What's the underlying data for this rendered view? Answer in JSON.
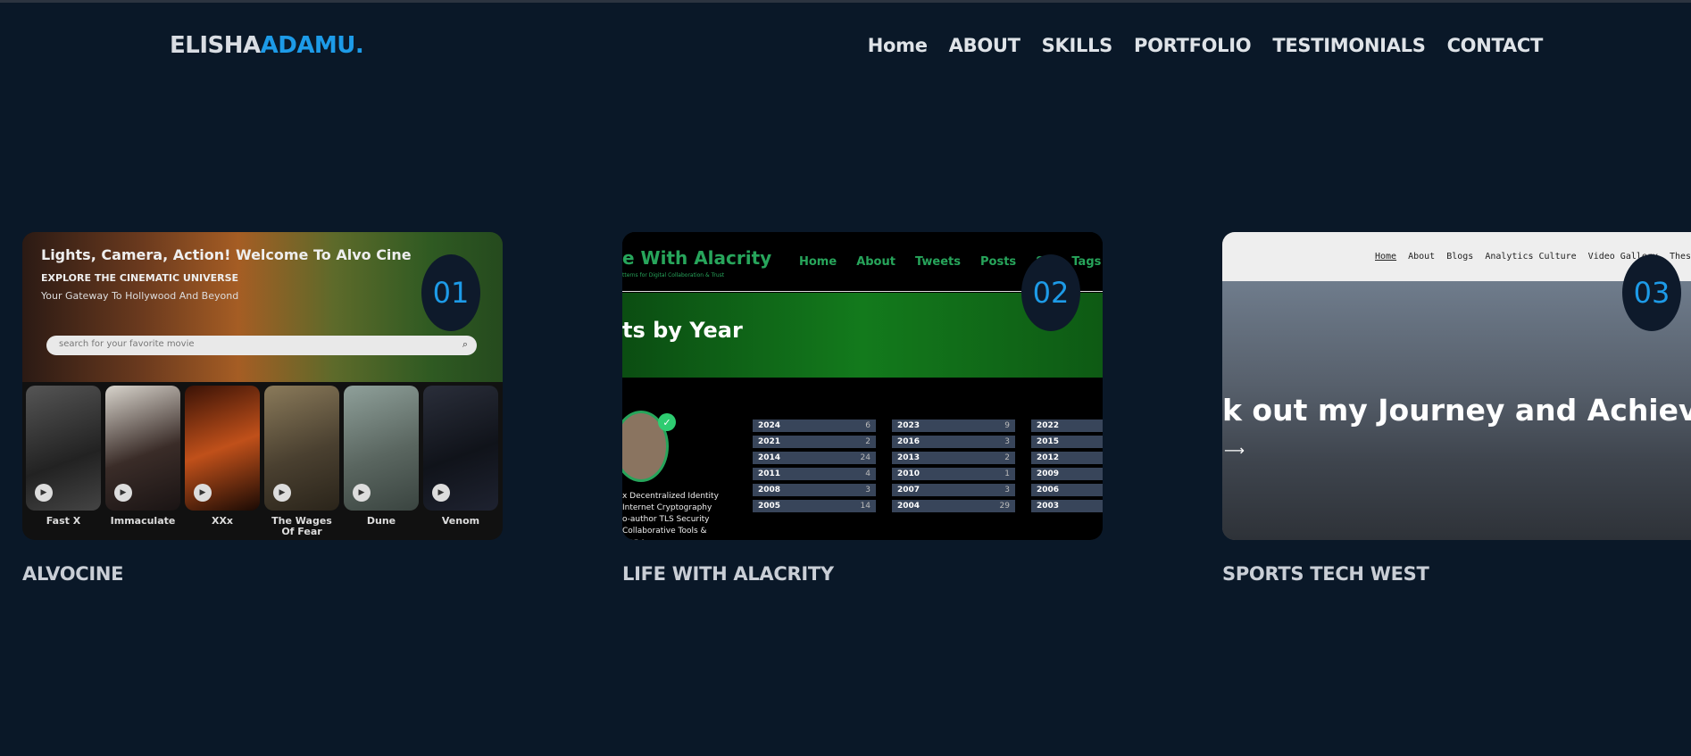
{
  "header": {
    "logo_first": "ELISHA",
    "logo_second": "ADAMU.",
    "nav": [
      "Home",
      "ABOUT",
      "SKILLS",
      "PORTFOLIO",
      "TESTIMONIALS",
      "CONTACT"
    ]
  },
  "projects": [
    {
      "number": "01",
      "title": "ALVOCINE",
      "preview": {
        "heading": "Lights, Camera, Action! Welcome To Alvo Cine",
        "subheading": "EXPLORE THE CINEMATIC UNIVERSE",
        "tagline": "Your Gateway To Hollywood And Beyond",
        "search_placeholder": "search for your favorite movie",
        "movies": [
          "Fast X",
          "Immaculate",
          "XXx",
          "The Wages Of Fear",
          "Dune",
          "Venom"
        ]
      }
    },
    {
      "number": "02",
      "title": "LIFE WITH ALACRITY",
      "preview": {
        "site_title": "e With Alacrity",
        "site_subtitle": "tterns for Digital Collaboration & Trust",
        "nav": [
          "Home",
          "About",
          "Tweets",
          "Posts",
          "Se",
          "Tags"
        ],
        "banner": "ts by Year",
        "bio": [
          "x Decentralized Identity",
          "Internet Cryptography",
          "o-author TLS Security",
          "Collaborative Tools &"
        ],
        "bio_year": "2024",
        "years": [
          [
            [
              "2024",
              "6"
            ],
            [
              "2023",
              "9"
            ],
            [
              "2022",
              ""
            ]
          ],
          [
            [
              "2021",
              "2"
            ],
            [
              "2016",
              "3"
            ],
            [
              "2015",
              ""
            ]
          ],
          [
            [
              "2014",
              "24"
            ],
            [
              "2013",
              "2"
            ],
            [
              "2012",
              ""
            ]
          ],
          [
            [
              "2011",
              "4"
            ],
            [
              "2010",
              "1"
            ],
            [
              "2009",
              ""
            ]
          ],
          [
            [
              "2008",
              "3"
            ],
            [
              "2007",
              "3"
            ],
            [
              "2006",
              ""
            ]
          ],
          [
            [
              "2005",
              "14"
            ],
            [
              "2004",
              "29"
            ],
            [
              "2003",
              ""
            ]
          ]
        ]
      }
    },
    {
      "number": "03",
      "title": "SPORTS TECH WEST",
      "preview": {
        "nav": [
          "Home",
          "About",
          "Blogs",
          "Analytics Culture",
          "Video Gallery",
          "Theses a"
        ],
        "headline": "k out my Journey and Achievemen",
        "arrow": "⟶"
      }
    }
  ],
  "colors": {
    "background": "#0a1828",
    "accent": "#1d9be8",
    "alacrity_green": "#27a55b"
  }
}
